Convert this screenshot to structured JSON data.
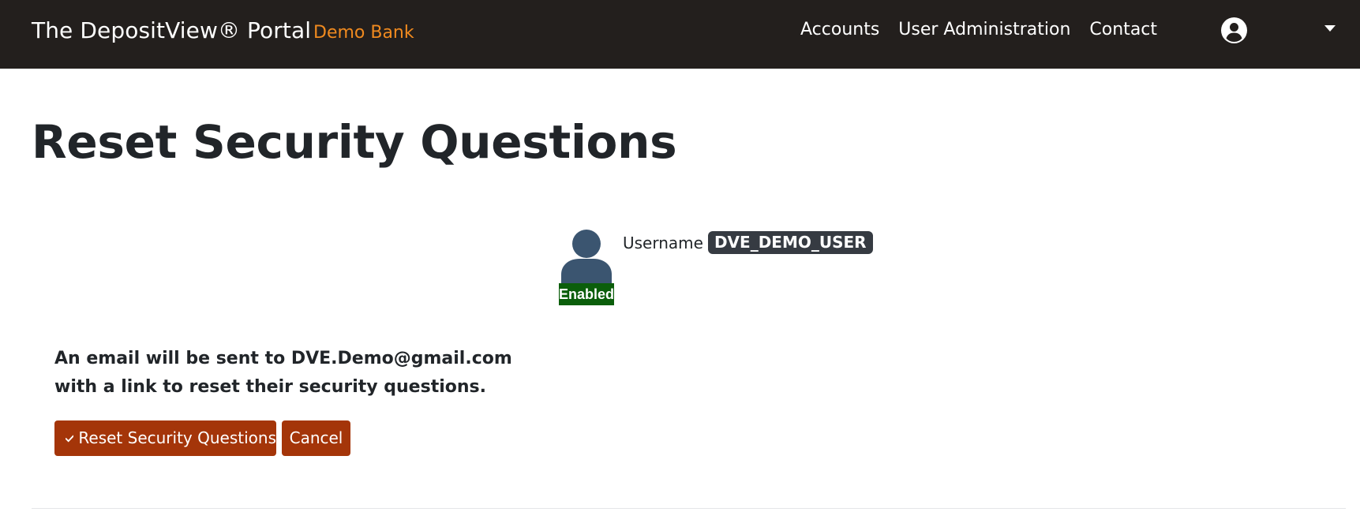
{
  "header": {
    "brand": "The DepositView® Portal",
    "bank_name": "Demo Bank",
    "nav": {
      "accounts": "Accounts",
      "user_administration": "User Administration",
      "contact": "Contact"
    },
    "icons": {
      "user": "user-circle-icon",
      "dropdown": "caret-down-icon"
    }
  },
  "page": {
    "title": "Reset Security Questions"
  },
  "user": {
    "status": "Enabled",
    "username_label": "Username",
    "username": "DVE_DEMO_USER",
    "icon": "user-silhouette-icon"
  },
  "message": {
    "line1": "An email will be sent to DVE.Demo@gmail.com",
    "line2": "with a link to reset their security questions."
  },
  "actions": {
    "reset_label": "Reset Security Questions",
    "reset_icon": "check-icon",
    "cancel_label": "Cancel"
  },
  "colors": {
    "navbar_bg": "#231f1d",
    "bank_accent": "#f08a1f",
    "button_bg": "#a43509",
    "status_enabled": "#0b5e0b",
    "username_pill": "#363b42",
    "avatar": "#3b5570"
  }
}
